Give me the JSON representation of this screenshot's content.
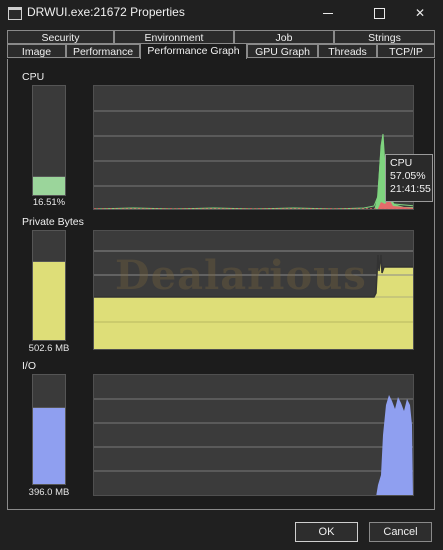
{
  "window": {
    "title": "DRWUI.exe:21672 Properties"
  },
  "tabs_row1": [
    "Security",
    "Environment",
    "Job",
    "Strings"
  ],
  "tabs_row2": [
    "Image",
    "Performance",
    "Performance Graph",
    "GPU Graph",
    "Threads",
    "TCP/IP"
  ],
  "active_tab": "Performance Graph",
  "sections": {
    "cpu": {
      "label": "CPU",
      "value_text": "16.51%",
      "level": 0.1651,
      "color": "#9bd59b"
    },
    "private_bytes": {
      "label": "Private Bytes",
      "value_text": "502.6 MB",
      "level": 0.72,
      "color": "#dede78"
    },
    "io": {
      "label": "I/O",
      "value_text": "396.0  MB",
      "level": 0.7,
      "color": "#8f9ff0"
    }
  },
  "tooltip": {
    "title": "CPU",
    "value": "57.05%",
    "time": "21:41:55"
  },
  "watermark": "Dealarious",
  "buttons": {
    "ok": "OK",
    "cancel": "Cancel"
  }
}
